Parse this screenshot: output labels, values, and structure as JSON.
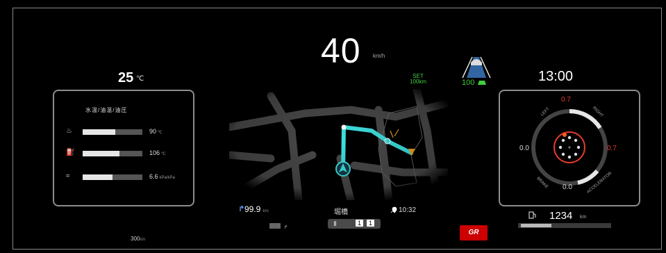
{
  "speedometer": {
    "value": "40",
    "unit": "km/h"
  },
  "outside_temp": {
    "value": "25",
    "unit": "℃"
  },
  "clock": "13:00",
  "left_panel": {
    "title": "水温/油温/油圧",
    "gauges": [
      {
        "icon": "coolant-temp-icon",
        "glyph": "♨",
        "level": 0.55,
        "value": "90",
        "unit": "℃"
      },
      {
        "icon": "oil-temp-icon",
        "glyph": "⛽",
        "level": 0.62,
        "value": "106",
        "unit": "℃"
      },
      {
        "icon": "oil-pressure-icon",
        "glyph": "≈",
        "level": 0.5,
        "value": "6.6",
        "unit": "kPa/kPa"
      }
    ]
  },
  "cruising_range": {
    "value": "300",
    "unit": "km"
  },
  "navigation": {
    "distance": "99.9",
    "distance_unit": "km",
    "street": "堀橋",
    "eta": "10:32",
    "gear_left": "1",
    "gear_right": "1"
  },
  "acc": {
    "set_line1": "SET",
    "set_line2": "100km",
    "speed": "100"
  },
  "g_meter": {
    "top_left_label": "LEFT",
    "top_right_label": "RIGHT",
    "bottom_left_label": "BRAKE",
    "bottom_right_label": "ACCELERATOR",
    "left_value": "0.0",
    "right_value": "0.7",
    "top_value": "0.7",
    "bottom_value": "0.0"
  },
  "odometer": {
    "value": "1234",
    "unit": "km"
  },
  "brand_logo_text": "GR",
  "colors": {
    "route": "#3fe0e0",
    "accent_red": "#e03a2f",
    "acc_green": "#3ecf3e",
    "destination": "#f0a020"
  }
}
